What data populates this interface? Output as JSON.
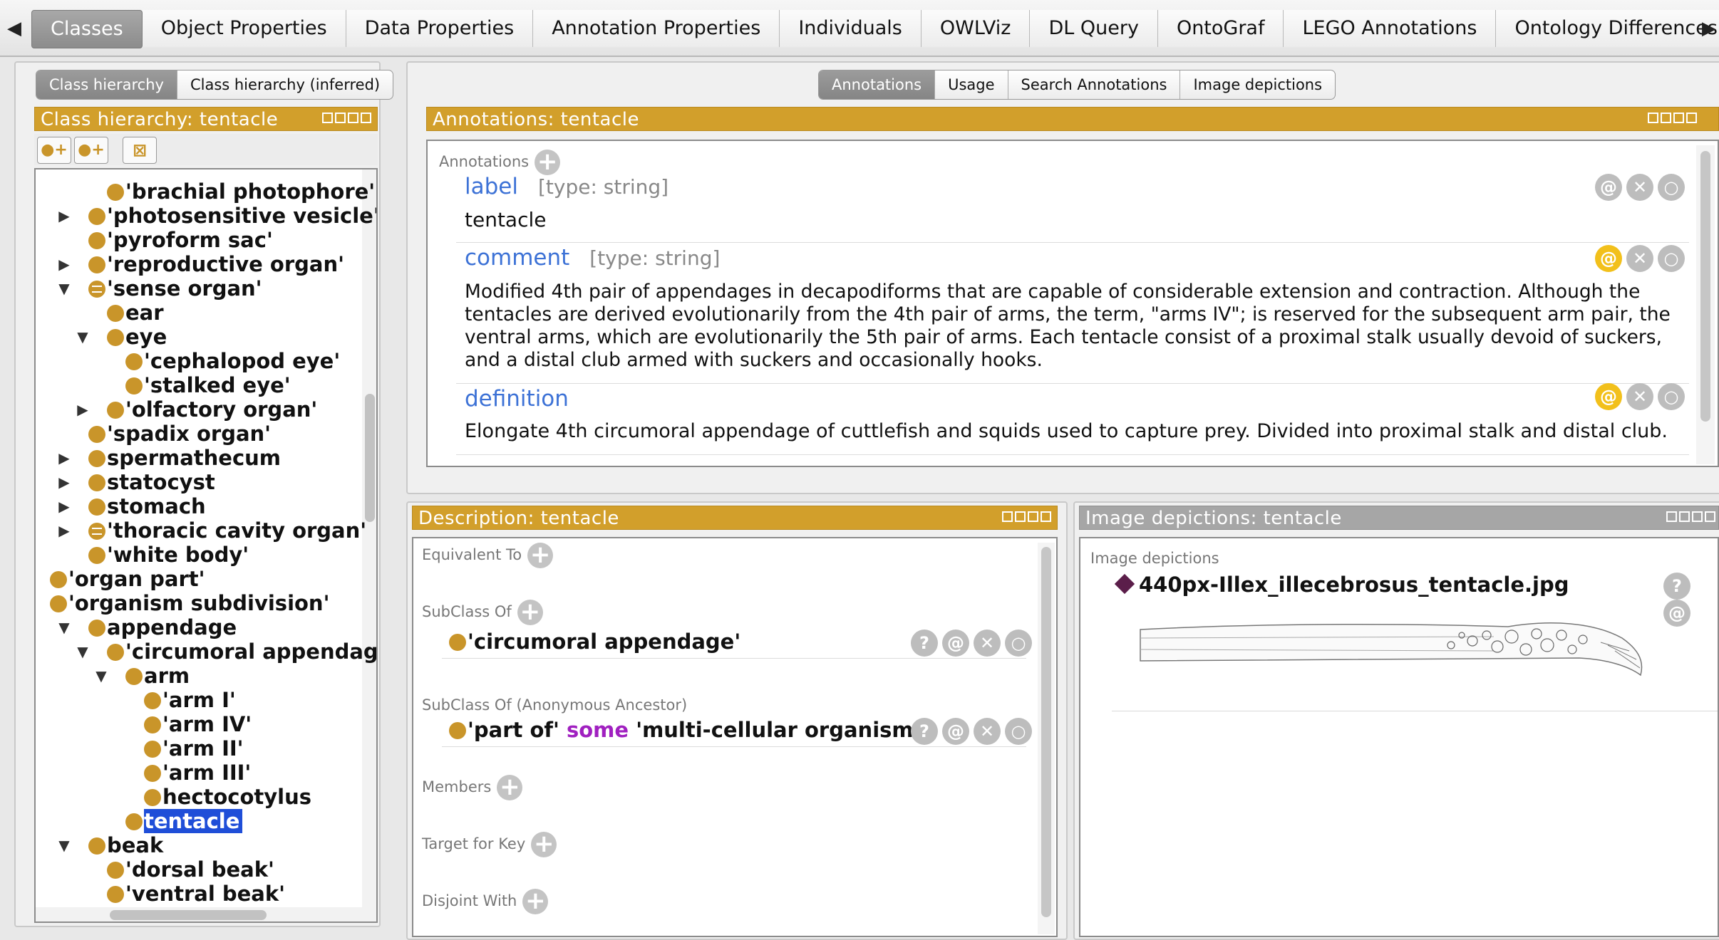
{
  "tabs": [
    "Classes",
    "Object Properties",
    "Data Properties",
    "Annotation Properties",
    "Individuals",
    "OWLViz",
    "DL Query",
    "OntoGraf",
    "LEGO Annotations",
    "Ontology Differences"
  ],
  "left": {
    "view_tabs": [
      "Class hierarchy",
      "Class hierarchy (inferred)"
    ],
    "title": "Class hierarchy: tentacle",
    "tree": [
      {
        "label": "'brachial photophore'"
      },
      {
        "label": "'photosensitive vesicle'",
        "toggle": "▶"
      },
      {
        "label": "'pyroform sac'"
      },
      {
        "label": "'reproductive organ'",
        "toggle": "▶"
      },
      {
        "label": "'sense organ'",
        "toggle": "▼",
        "equiv": true
      },
      {
        "label": "ear"
      },
      {
        "label": "eye",
        "toggle": "▼"
      },
      {
        "label": "'cephalopod eye'"
      },
      {
        "label": "'stalked eye'"
      },
      {
        "label": "'olfactory organ'",
        "toggle": "▶"
      },
      {
        "label": "'spadix organ'"
      },
      {
        "label": "spermathecum",
        "toggle": "▶"
      },
      {
        "label": "statocyst",
        "toggle": "▶"
      },
      {
        "label": "stomach",
        "toggle": "▶"
      },
      {
        "label": "'thoracic cavity organ'",
        "toggle": "▶",
        "equiv": true
      },
      {
        "label": "'white body'"
      },
      {
        "label": "'organ part'"
      },
      {
        "label": "'organism subdivision'"
      },
      {
        "label": "appendage",
        "toggle": "▼"
      },
      {
        "label": "'circumoral appendage'",
        "toggle": "▼"
      },
      {
        "label": "arm",
        "toggle": "▼"
      },
      {
        "label": "'arm I'"
      },
      {
        "label": "'arm IV'"
      },
      {
        "label": "'arm II'"
      },
      {
        "label": "'arm III'"
      },
      {
        "label": "hectocotylus"
      },
      {
        "label": "tentacle",
        "selected": true
      },
      {
        "label": "beak",
        "toggle": "▼"
      },
      {
        "label": "'dorsal beak'"
      },
      {
        "label": "'ventral beak'"
      }
    ]
  },
  "annotations_panel": {
    "view_tabs": [
      "Annotations",
      "Usage",
      "Search Annotations",
      "Image depictions"
    ],
    "title": "Annotations: tentacle",
    "section": "Annotations",
    "items": [
      {
        "prop": "label",
        "type": "[type: string]",
        "value": "tentacle"
      },
      {
        "prop": "comment",
        "type": "[type: string]",
        "value": "Modified 4th pair of appendages in decapodiforms that are capable of considerable extension and contraction. Although the tentacles are derived evolutionarily from the 4th pair of arms, the term, \"arms IV\"; is reserved for the subsequent arm pair, the ventral arms, which are evolutionarily the 5th pair of arms. Each tentacle consist of a proximal stalk usually devoid of suckers, and a distal club armed with suckers and occasionally hooks."
      },
      {
        "prop": "definition",
        "type": "",
        "value": "Elongate 4th circumoral appendage of cuttlefish and squids used to capture prey. Divided into proximal stalk and distal club."
      }
    ]
  },
  "description": {
    "title": "Description: tentacle",
    "sections": {
      "equivalent": "Equivalent To",
      "subclass": "SubClass Of",
      "subclass_item": "'circumoral appendage'",
      "ancestor": "SubClass Of (Anonymous Ancestor)",
      "ancestor_prop": "'part of'",
      "ancestor_kw": "some",
      "ancestor_filler": "'multi-cellular organism'",
      "members": "Members",
      "target": "Target for Key",
      "disjoint": "Disjoint With"
    }
  },
  "images": {
    "title": "Image depictions: tentacle",
    "section": "Image depictions",
    "file": "440px-Illex_illecebrosus_tentacle.jpg"
  },
  "colors": {
    "accent": "#d29f2b",
    "link": "#3d72d6",
    "keyword": "#a020c0",
    "selection": "#1f4ed8"
  }
}
